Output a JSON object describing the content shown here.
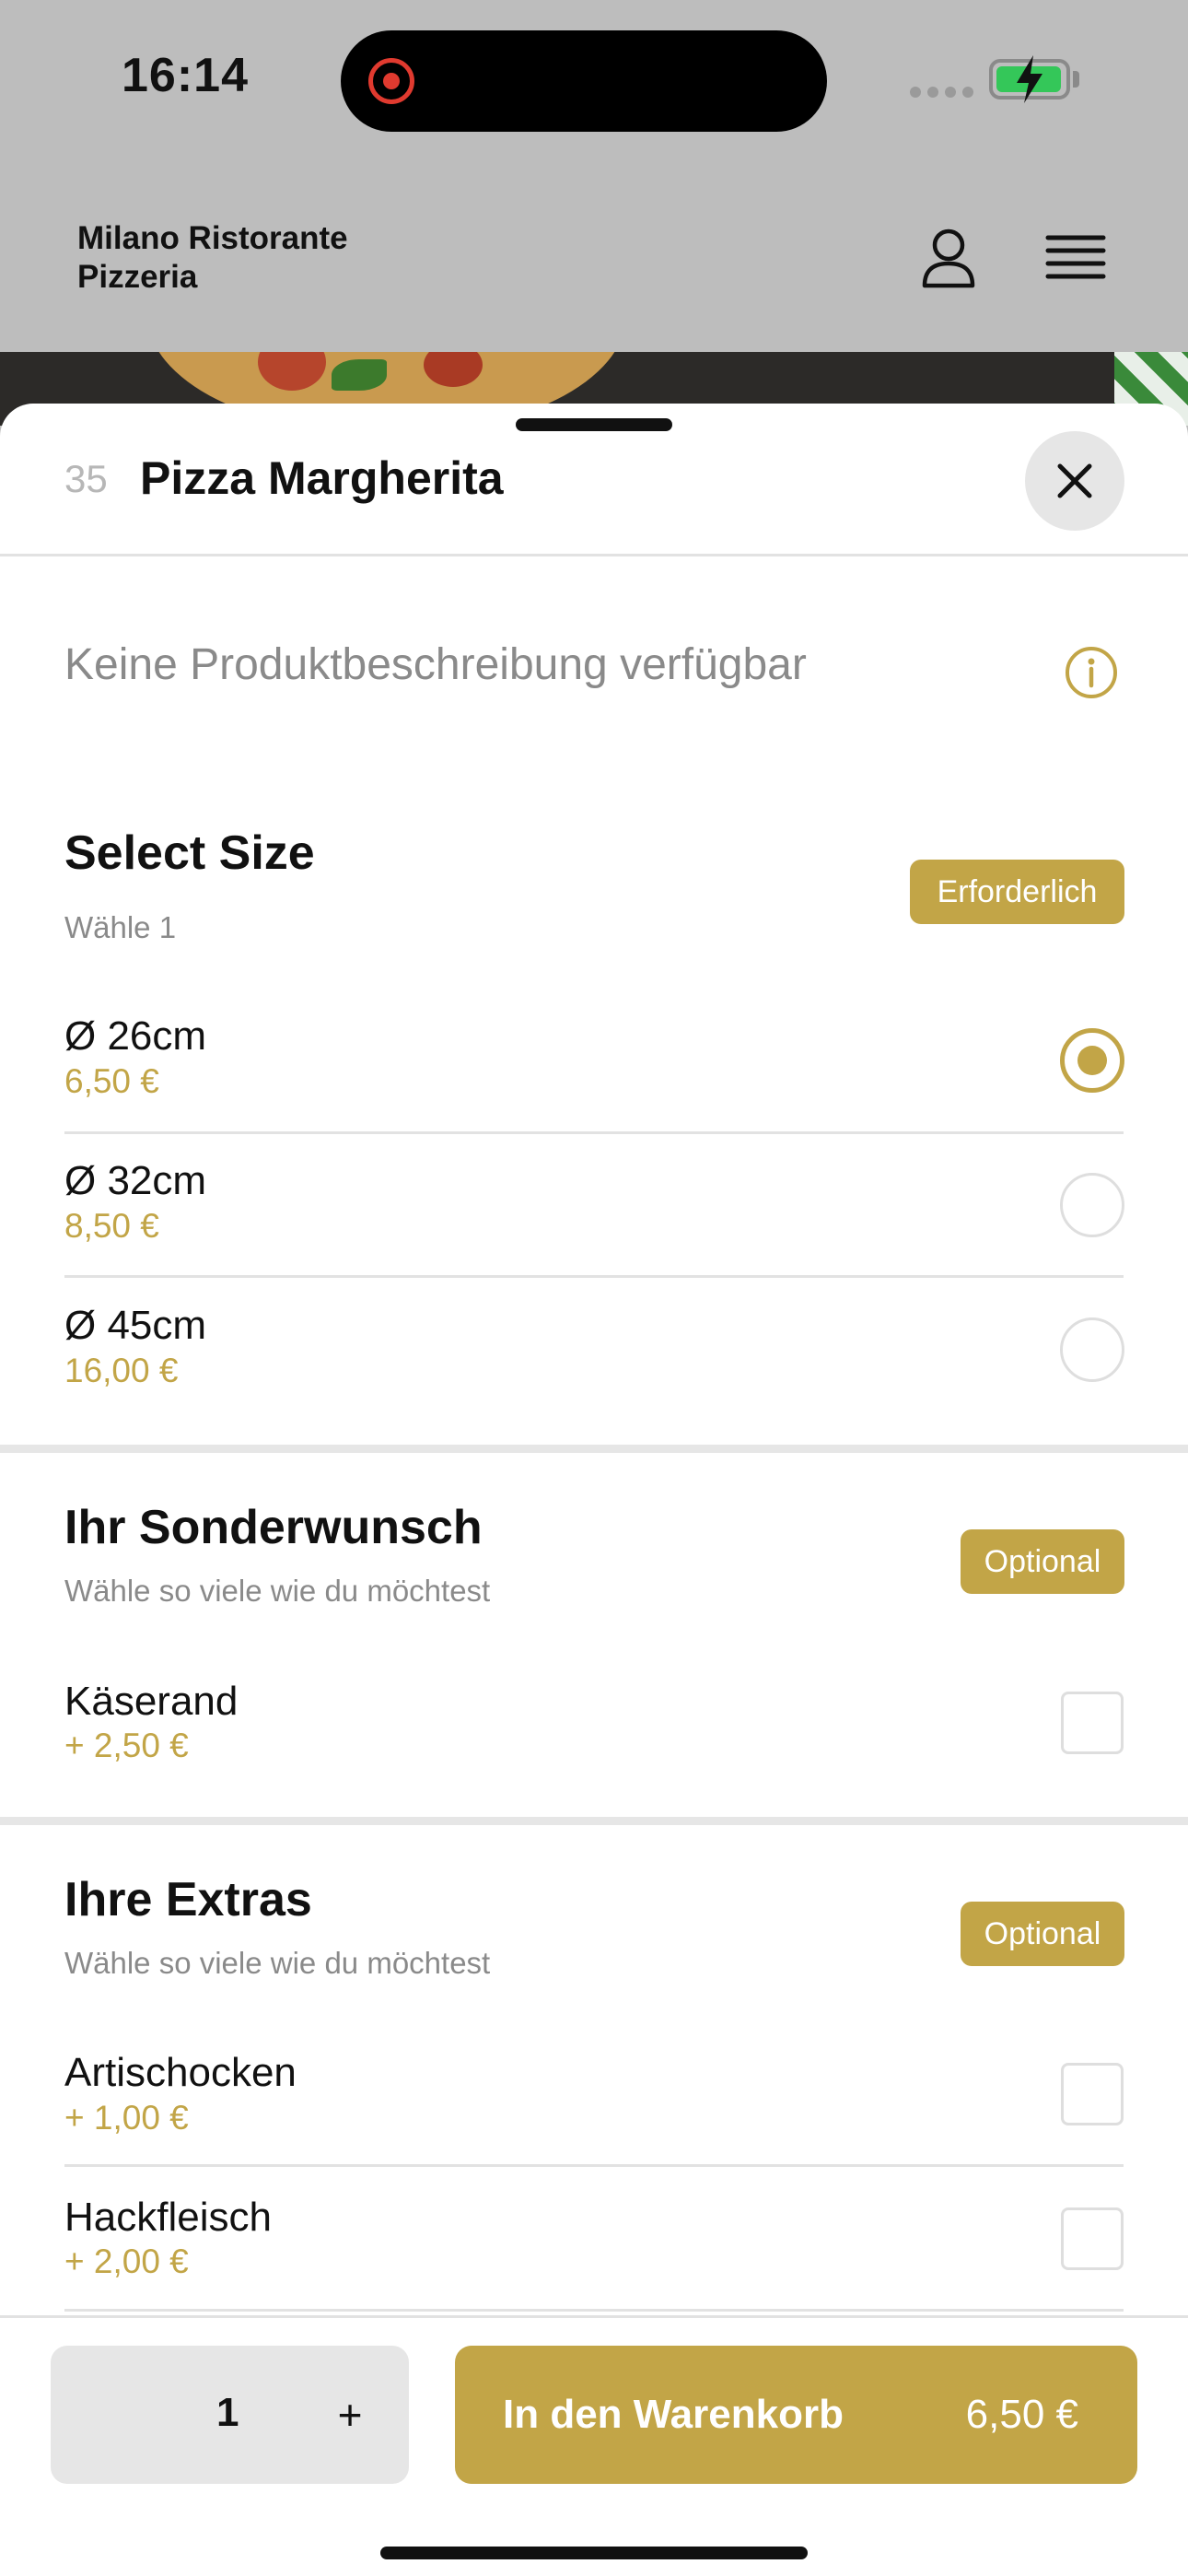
{
  "status_bar": {
    "time": "16:14"
  },
  "header": {
    "brand_line1": "Milano Ristorante",
    "brand_line2": "Pizzeria"
  },
  "product": {
    "number": "35",
    "title": "Pizza Margherita",
    "description": "Keine Produktbeschreibung verfügbar"
  },
  "size_section": {
    "title": "Select Size",
    "subtitle": "Wähle 1",
    "badge": "Erforderlich",
    "options": [
      {
        "name": "Ø 26cm",
        "price": "6,50 €",
        "selected": true
      },
      {
        "name": "Ø 32cm",
        "price": "8,50 €",
        "selected": false
      },
      {
        "name": "Ø 45cm",
        "price": "16,00 €",
        "selected": false
      }
    ]
  },
  "special_section": {
    "title": "Ihr Sonderwunsch",
    "subtitle": "Wähle so viele wie du möchtest",
    "badge": "Optional",
    "options": [
      {
        "name": "Käserand",
        "price": "+ 2,50 €",
        "checked": false
      }
    ]
  },
  "extras_section": {
    "title": "Ihre Extras",
    "subtitle": "Wähle so viele wie du möchtest",
    "badge": "Optional",
    "options": [
      {
        "name": "Artischocken",
        "price": "+ 1,00 €",
        "checked": false
      },
      {
        "name": "Hackfleisch",
        "price": "+ 2,00 €",
        "checked": false
      }
    ]
  },
  "bottom_bar": {
    "quantity": "1",
    "plus_label": "+",
    "cart_label": "In den Warenkorb",
    "cart_total": "6,50 €"
  },
  "colors": {
    "accent": "#c2a547",
    "header_bg": "#bdbdbd",
    "battery": "#34c759",
    "recording": "#e03a2f"
  },
  "icons": [
    "user-icon",
    "menu-icon",
    "close-icon",
    "info-icon",
    "recording-icon",
    "battery-icon"
  ]
}
